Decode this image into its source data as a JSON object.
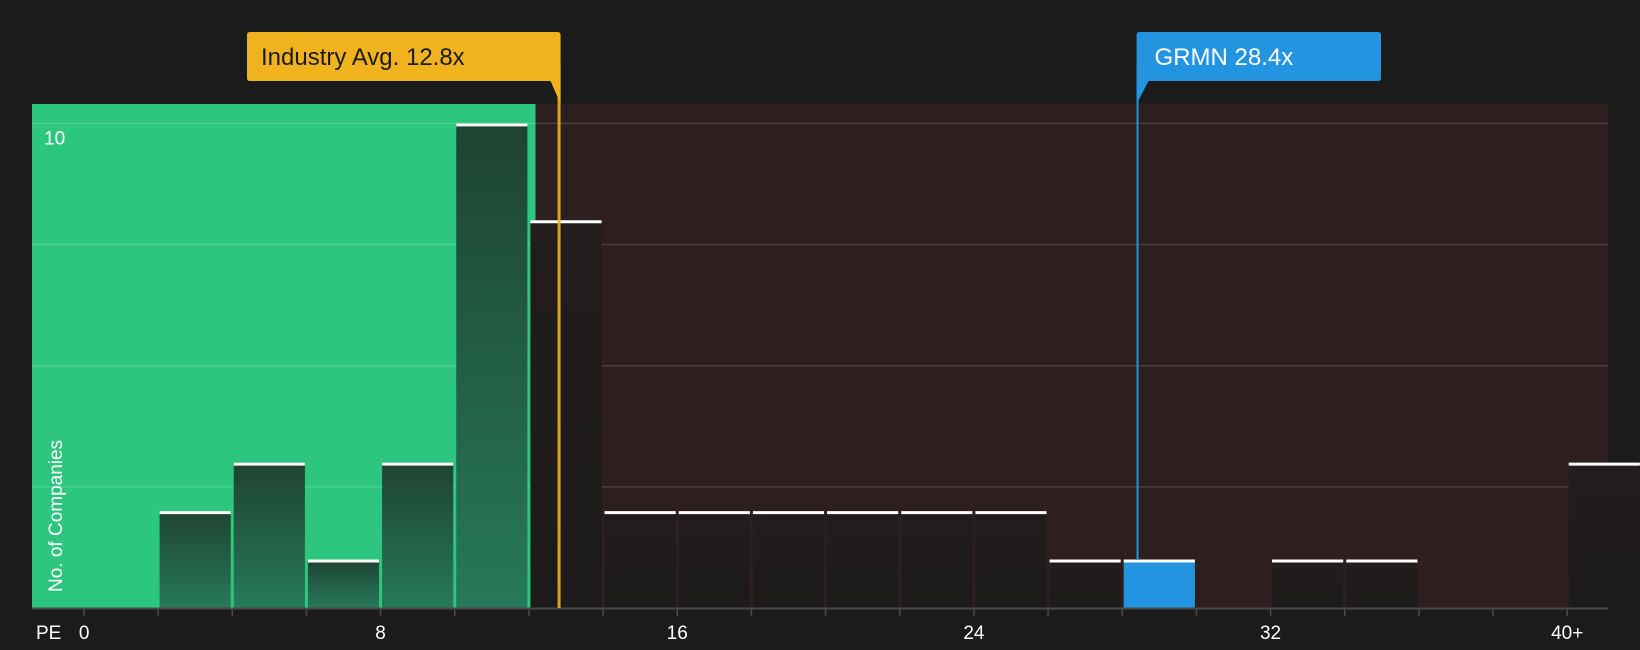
{
  "chart_data": {
    "type": "bar",
    "title": "",
    "xlabel": "PE",
    "ylabel": "No. of Companies",
    "x_tick_labels": [
      "0",
      "8",
      "16",
      "24",
      "32",
      "40+"
    ],
    "x_tick_values": [
      0,
      8,
      16,
      24,
      32,
      40
    ],
    "y_tick_labels": [
      "10"
    ],
    "ylim": [
      0,
      10.4
    ],
    "xlim": [
      -1.4,
      41.1
    ],
    "bin_width": 2,
    "bins": [
      {
        "start": 2,
        "count": 2
      },
      {
        "start": 4,
        "count": 3
      },
      {
        "start": 6,
        "count": 1
      },
      {
        "start": 8,
        "count": 3
      },
      {
        "start": 10,
        "count": 10
      },
      {
        "start": 12,
        "count": 8
      },
      {
        "start": 14,
        "count": 2
      },
      {
        "start": 16,
        "count": 2
      },
      {
        "start": 18,
        "count": 2
      },
      {
        "start": 20,
        "count": 2
      },
      {
        "start": 22,
        "count": 2
      },
      {
        "start": 24,
        "count": 2
      },
      {
        "start": 26,
        "count": 1
      },
      {
        "start": 28,
        "count": 1,
        "highlight": true
      },
      {
        "start": 32,
        "count": 1
      },
      {
        "start": 34,
        "count": 1
      },
      {
        "start": 40,
        "count": 3
      }
    ],
    "industry_avg": {
      "label": "Industry Avg. 12.8x",
      "value": 12.8
    },
    "company": {
      "label": "GRMN 28.4x",
      "ticker": "GRMN",
      "value": 28.4
    },
    "grid": true
  },
  "colors": {
    "background": "#1b1b1b",
    "undervalued_region": "#2dc67f",
    "overvalued_region": "#2d1f1f",
    "industry_accent": "#f0b21d",
    "company_accent": "#2394e0",
    "bar_top": "#ffffff"
  }
}
